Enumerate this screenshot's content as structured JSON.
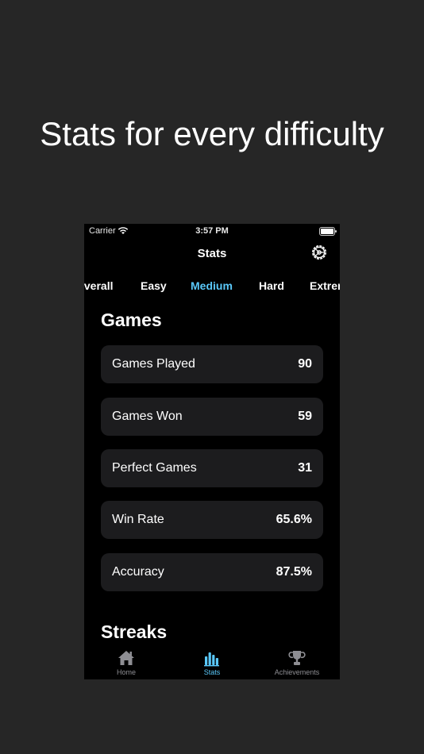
{
  "headline": "Stats for every difficulty",
  "status_bar": {
    "carrier": "Carrier",
    "time": "3:57 PM"
  },
  "nav": {
    "title": "Stats"
  },
  "tabs": [
    {
      "label": "Overall"
    },
    {
      "label": "Easy"
    },
    {
      "label": "Medium",
      "selected": true
    },
    {
      "label": "Hard"
    },
    {
      "label": "Extreme"
    }
  ],
  "sections": {
    "games": {
      "title": "Games",
      "rows": [
        {
          "label": "Games Played",
          "value": "90"
        },
        {
          "label": "Games Won",
          "value": "59"
        },
        {
          "label": "Perfect Games",
          "value": "31"
        },
        {
          "label": "Win Rate",
          "value": "65.6%"
        },
        {
          "label": "Accuracy",
          "value": "87.5%"
        }
      ]
    },
    "streaks": {
      "title": "Streaks"
    }
  },
  "tabbar": {
    "items": [
      {
        "label": "Home",
        "icon": "house-icon"
      },
      {
        "label": "Stats",
        "icon": "bar-chart-icon",
        "selected": true
      },
      {
        "label": "Achievements",
        "icon": "trophy-icon"
      }
    ]
  },
  "colors": {
    "accent": "#5ac8fa",
    "background": "#262626",
    "card": "#1c1c1e"
  }
}
